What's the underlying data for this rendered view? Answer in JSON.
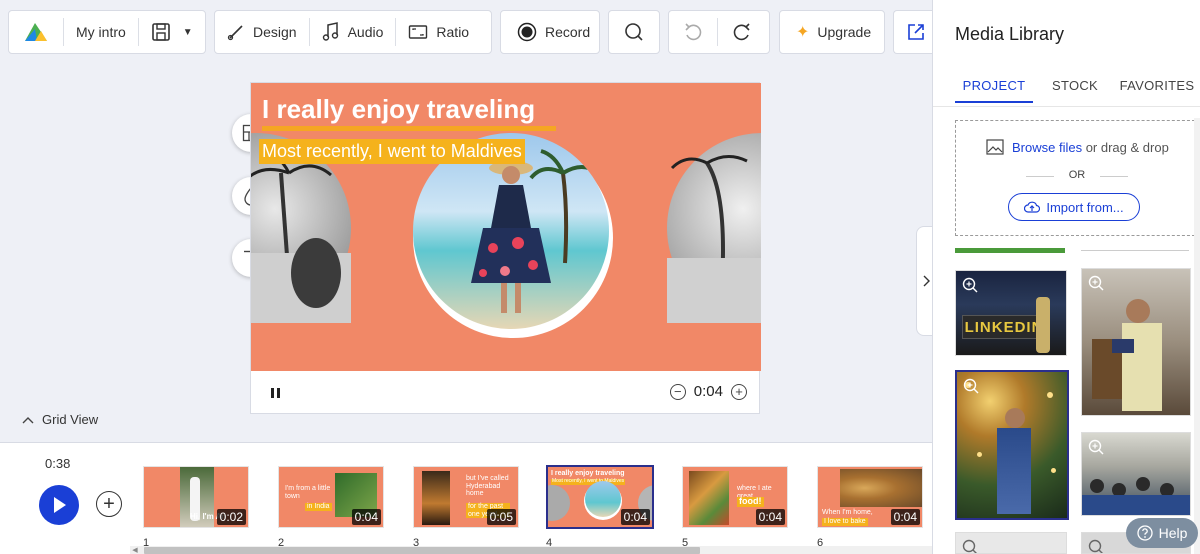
{
  "toolbar": {
    "project_name": "My intro",
    "design_label": "Design",
    "audio_label": "Audio",
    "ratio_label": "Ratio",
    "record_label": "Record",
    "upgrade_label": "Upgrade"
  },
  "slide": {
    "title": "I really enjoy traveling",
    "subtitle": "Most recently, I went to Maldives",
    "current_time": "0:04"
  },
  "grid_view_label": "Grid View",
  "timeline": {
    "total_duration": "0:38",
    "thumbnails": [
      {
        "number": "1",
        "duration": "0:02",
        "caption": "Hi, I'm An"
      },
      {
        "number": "2",
        "duration": "0:04",
        "caption_main": "I'm from a little town",
        "caption_highlight": "in India"
      },
      {
        "number": "3",
        "duration": "0:05",
        "caption_main": "but I've called Hyderabad home",
        "caption_highlight": "for the past one year!"
      },
      {
        "number": "4",
        "duration": "0:04",
        "caption_main": "I really enjoy traveling",
        "caption_highlight": "Most recently, I went to Maldives"
      },
      {
        "number": "5",
        "duration": "0:04",
        "caption_main": "where I ate great",
        "caption_highlight": "food!"
      },
      {
        "number": "6",
        "duration": "0:04",
        "caption_main": "When I'm home,",
        "caption_highlight": "I love to bake"
      }
    ]
  },
  "media_library": {
    "title": "Media Library",
    "tabs": [
      "PROJECT",
      "STOCK",
      "FAVORITES"
    ],
    "active_tab": "PROJECT",
    "browse_link": "Browse files",
    "browse_suffix": "or drag & drop",
    "or_label": "OR",
    "import_label": "Import from...",
    "linkedin_sign": "LINKEDIN"
  },
  "help_label": "Help",
  "colors": {
    "accent_blue": "#1a3fd6",
    "slide_bg": "#f18867",
    "title_underline": "#f5a623",
    "subtitle_bg": "#f5b21c",
    "selected_border": "#2a2f8c"
  }
}
